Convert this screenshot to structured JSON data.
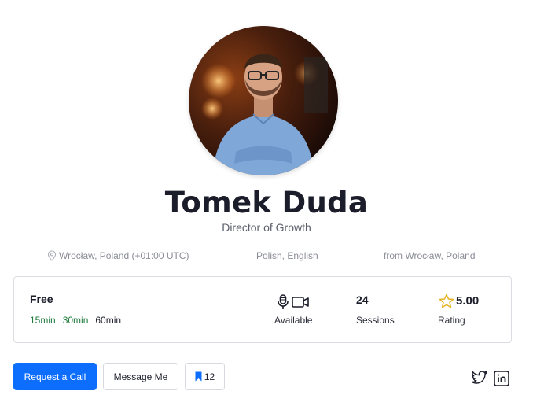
{
  "profile": {
    "name": "Tomek Duda",
    "role": "Director of Growth",
    "location": "Wrocław, Poland (+01:00 UTC)",
    "languages": "Polish, English",
    "from": "from Wrocław, Poland"
  },
  "card": {
    "price": "Free",
    "durations": [
      "15min",
      "30min",
      "60min"
    ],
    "availability_label": "Available",
    "sessions_count": "24",
    "sessions_label": "Sessions",
    "rating_value": "5.00",
    "rating_label": "Rating"
  },
  "actions": {
    "request_call": "Request a Call",
    "message": "Message Me",
    "bookmark_count": "12"
  },
  "icons": {
    "location": "map-pin-icon",
    "mic": "microphone-icon",
    "video": "video-camera-icon",
    "star": "star-icon",
    "bookmark": "bookmark-icon",
    "twitter": "twitter-icon",
    "linkedin": "linkedin-icon"
  },
  "colors": {
    "primary": "#0d6efd",
    "duration_green": "#1e7a3c",
    "star": "#e6b120"
  }
}
